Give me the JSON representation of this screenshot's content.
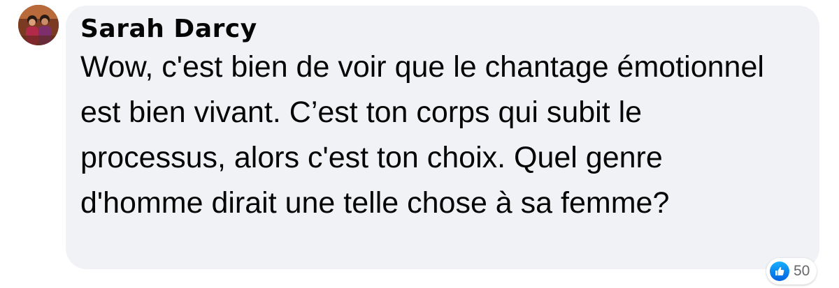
{
  "comment": {
    "author": "Sarah Darcy",
    "text": "Wow, c'est bien de voir que le chantage émotionnel est bien vivant. C’est ton corps qui subit le processus, alors c'est ton choix. Quel genre d'homme dirait une telle chose à sa femme?",
    "avatar_icon": "profile-photo",
    "reactions": {
      "icon": "thumbs-up-icon",
      "count": "50",
      "color": "#1877f2"
    }
  }
}
